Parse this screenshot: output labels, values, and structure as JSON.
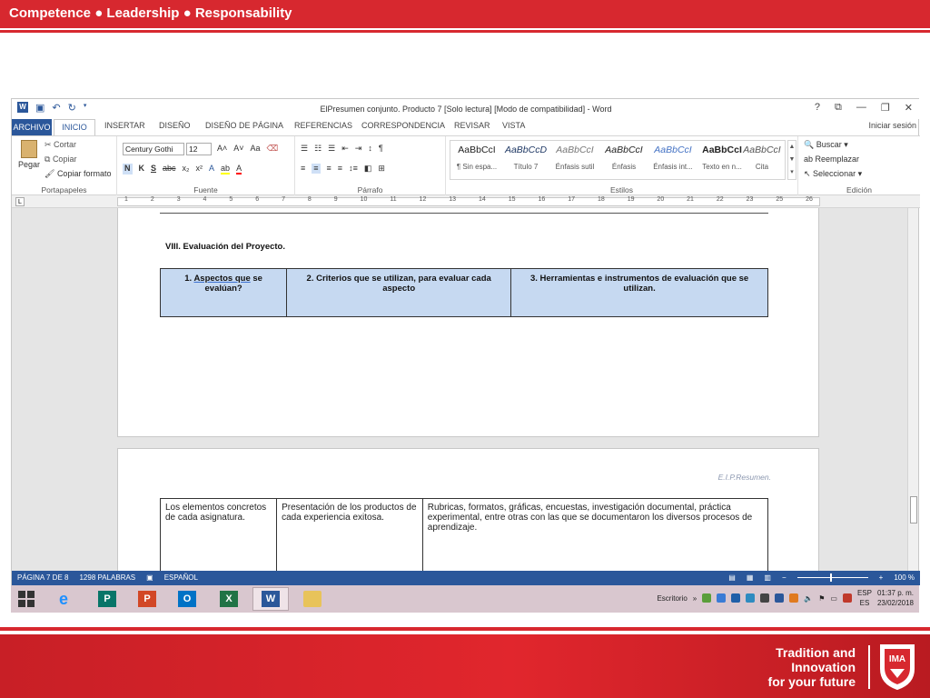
{
  "slide": {
    "tagline": "Competence ● Leadership ● Responsability",
    "motto_lines": [
      "Tradition and",
      "Innovation",
      "for your future"
    ],
    "crest_text": "IMA"
  },
  "window": {
    "title": "ElPresumen conjunto. Producto 7 [Solo lectura] [Modo de compatibilidad] - Word",
    "controls": [
      "?",
      "⧉",
      "—",
      "❐",
      "✕"
    ],
    "signin": "Iniciar sesión"
  },
  "tabs": [
    "ARCHIVO",
    "INICIO",
    "INSERTAR",
    "DISEÑO",
    "DISEÑO DE PÁGINA",
    "REFERENCIAS",
    "CORRESPONDENCIA",
    "REVISAR",
    "VISTA"
  ],
  "ribbon": {
    "clipboard": {
      "paste": "Pegar",
      "cut": "Cortar",
      "copy": "Copiar",
      "format_painter": "Copiar formato",
      "label": "Portapapeles"
    },
    "font": {
      "name": "Century Gothi",
      "size": "12",
      "label": "Fuente",
      "buttons": [
        "N",
        "K",
        "S",
        "abc",
        "x₂",
        "x²"
      ]
    },
    "paragraph": {
      "label": "Párrafo"
    },
    "styles": {
      "label": "Estilos",
      "items": [
        {
          "sample": "AaBbCcI",
          "name": "¶ Sin espa..."
        },
        {
          "sample": "AaBbCcD",
          "name": "Título 7"
        },
        {
          "sample": "AaBbCcI",
          "name": "Énfasis sutil"
        },
        {
          "sample": "AaBbCcI",
          "name": "Énfasis"
        },
        {
          "sample": "AaBbCcI",
          "name": "Énfasis int..."
        },
        {
          "sample": "AaBbCcI",
          "name": "Texto en n..."
        },
        {
          "sample": "AaBbCcI",
          "name": "Cita"
        }
      ]
    },
    "editing": {
      "find": "Buscar",
      "replace": "Reemplazar",
      "select": "Seleccionar",
      "label": "Edición"
    }
  },
  "ruler_numbers": [
    "1",
    "2",
    "3",
    "4",
    "5",
    "6",
    "7",
    "8",
    "9",
    "10",
    "11",
    "12",
    "13",
    "14",
    "15",
    "16",
    "17",
    "18",
    "19",
    "20",
    "21",
    "22",
    "23",
    "25",
    "26"
  ],
  "document": {
    "heading": "VIII. Evaluación del Proyecto.",
    "eval_table": [
      {
        "prefix": "1. ",
        "underlined": "Aspectos  que",
        "suffix": " se evalúan?"
      },
      {
        "prefix": "2. Criterios que se utilizan, para evaluar cada aspecto",
        "underlined": "",
        "suffix": ""
      },
      {
        "prefix": "3. Herramientas e instrumentos de evaluación que se utilizan.",
        "underlined": "",
        "suffix": ""
      }
    ],
    "page2_header": "E.I.P.Resumen.",
    "content_table": [
      "Los elementos concretos de cada asignatura.",
      "Presentación de los productos de cada experiencia exitosa.",
      "Rubricas, formatos, gráficas, encuestas, investigación documental, práctica experimental, entre otras con las que se documentaron los diversos procesos de aprendizaje."
    ]
  },
  "status": {
    "page": "PÁGINA 7 DE 8",
    "words": "1298 PALABRAS",
    "language": "ESPAÑOL",
    "zoom": "100 %"
  },
  "taskbar": {
    "desktop_label": "Escritorio",
    "lang": "ESP",
    "lang2": "ES",
    "time": "01:37 p. m.",
    "date": "23/02/2018"
  },
  "colors": {
    "brand_red": "#d7282f",
    "word_blue": "#2b579a",
    "table_fill": "#c6d9f1"
  }
}
